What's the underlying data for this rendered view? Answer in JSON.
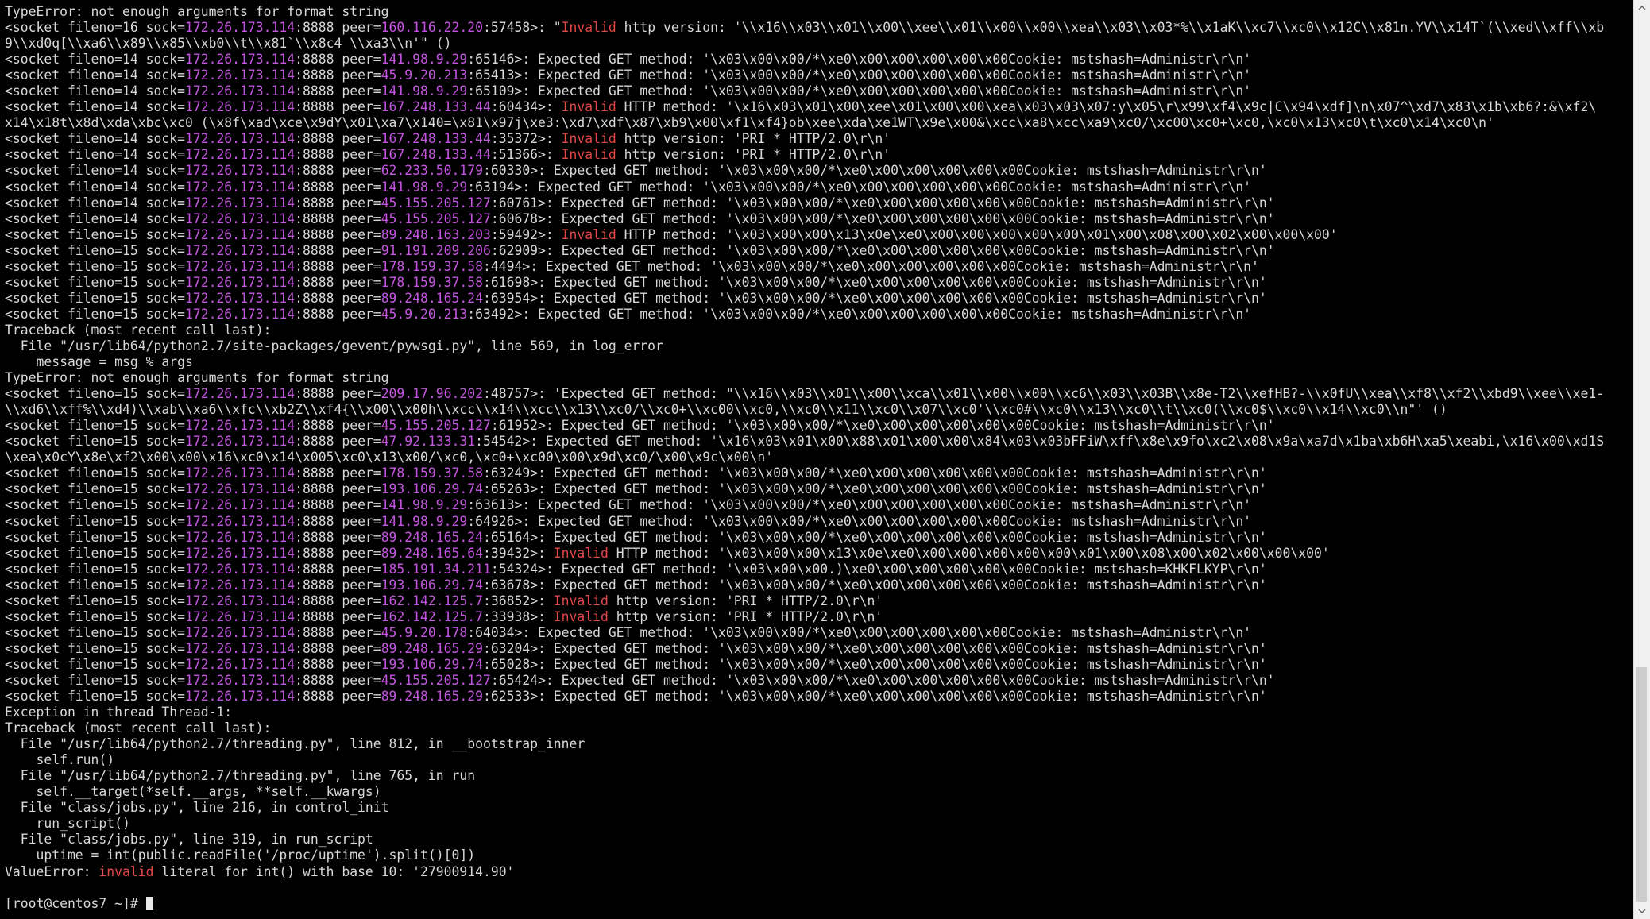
{
  "colors": {
    "background": "#000000",
    "text": "#d8d8d8",
    "ip_highlight": "#c455e0",
    "invalid_highlight": "#e04848",
    "scrollbar_track": "#f0f0f0",
    "scrollbar_thumb": "#cdcdcd"
  },
  "terminal": {
    "lines": [
      [
        {
          "t": "TypeError: not enough arguments for format string"
        }
      ],
      [
        {
          "t": "<socket fileno=16 sock="
        },
        {
          "t": "172.26.173.114",
          "c": "ip"
        },
        {
          "t": ":8888 peer="
        },
        {
          "t": "160.116.22.20",
          "c": "ip"
        },
        {
          "t": ":57458>: \""
        },
        {
          "t": "Invalid",
          "c": "kw"
        },
        {
          "t": " http version: '\\\\x16\\\\x03\\\\x01\\\\x00\\\\xee\\\\x01\\\\x00\\\\x00\\\\xea\\\\x03\\\\x03*%\\\\x1aK\\\\xc7\\\\xc0\\\\x12C\\\\x81n.YV\\\\x14T`(\\\\xed\\\\xff\\\\xb"
        }
      ],
      [
        {
          "t": "9\\\\xd0q[\\\\xa6\\\\x89\\\\x85\\\\xb0\\\\t\\\\x81`\\\\x8c4 \\\\xa3\\\\n'\" ()"
        }
      ],
      [
        {
          "t": "<socket fileno=14 sock="
        },
        {
          "t": "172.26.173.114",
          "c": "ip"
        },
        {
          "t": ":8888 peer="
        },
        {
          "t": "141.98.9.29",
          "c": "ip"
        },
        {
          "t": ":65146>: Expected GET method: '\\x03\\x00\\x00/*\\xe0\\x00\\x00\\x00\\x00\\x00Cookie: mstshash=Administr\\r\\n'"
        }
      ],
      [
        {
          "t": "<socket fileno=14 sock="
        },
        {
          "t": "172.26.173.114",
          "c": "ip"
        },
        {
          "t": ":8888 peer="
        },
        {
          "t": "45.9.20.213",
          "c": "ip"
        },
        {
          "t": ":65413>: Expected GET method: '\\x03\\x00\\x00/*\\xe0\\x00\\x00\\x00\\x00\\x00Cookie: mstshash=Administr\\r\\n'"
        }
      ],
      [
        {
          "t": "<socket fileno=14 sock="
        },
        {
          "t": "172.26.173.114",
          "c": "ip"
        },
        {
          "t": ":8888 peer="
        },
        {
          "t": "141.98.9.29",
          "c": "ip"
        },
        {
          "t": ":65109>: Expected GET method: '\\x03\\x00\\x00/*\\xe0\\x00\\x00\\x00\\x00\\x00Cookie: mstshash=Administr\\r\\n'"
        }
      ],
      [
        {
          "t": "<socket fileno=14 sock="
        },
        {
          "t": "172.26.173.114",
          "c": "ip"
        },
        {
          "t": ":8888 peer="
        },
        {
          "t": "167.248.133.44",
          "c": "ip"
        },
        {
          "t": ":60434>: "
        },
        {
          "t": "Invalid",
          "c": "kw"
        },
        {
          "t": " HTTP method: '\\x16\\x03\\x01\\x00\\xee\\x01\\x00\\x00\\xea\\x03\\x03\\x07:y\\x05\\r\\x99\\xf4\\x9c|C\\x94\\xdf]\\n\\x07^\\xd7\\x83\\x1b\\xb6?:&\\xf2\\"
        }
      ],
      [
        {
          "t": "x14\\x18t\\x8d\\xda\\xbc\\xc0 (\\x8f\\xad\\xce\\x9dY\\x01\\xa7\\x140=\\x81\\x97j\\xe3:\\xd7\\xdf\\x87\\xb9\\x00\\xf1\\xf4}ob\\xee\\xda\\xe1WT\\x9e\\x00&\\xcc\\xa8\\xcc\\xa9\\xc0/\\xc00\\xc0+\\xc0,\\xc0\\x13\\xc0\\t\\xc0\\x14\\xc0\\n'"
        }
      ],
      [
        {
          "t": "<socket fileno=14 sock="
        },
        {
          "t": "172.26.173.114",
          "c": "ip"
        },
        {
          "t": ":8888 peer="
        },
        {
          "t": "167.248.133.44",
          "c": "ip"
        },
        {
          "t": ":35372>: "
        },
        {
          "t": "Invalid",
          "c": "kw"
        },
        {
          "t": " http version: 'PRI * HTTP/2.0\\r\\n'"
        }
      ],
      [
        {
          "t": "<socket fileno=14 sock="
        },
        {
          "t": "172.26.173.114",
          "c": "ip"
        },
        {
          "t": ":8888 peer="
        },
        {
          "t": "167.248.133.44",
          "c": "ip"
        },
        {
          "t": ":51366>: "
        },
        {
          "t": "Invalid",
          "c": "kw"
        },
        {
          "t": " http version: 'PRI * HTTP/2.0\\r\\n'"
        }
      ],
      [
        {
          "t": "<socket fileno=14 sock="
        },
        {
          "t": "172.26.173.114",
          "c": "ip"
        },
        {
          "t": ":8888 peer="
        },
        {
          "t": "62.233.50.179",
          "c": "ip"
        },
        {
          "t": ":60330>: Expected GET method: '\\x03\\x00\\x00/*\\xe0\\x00\\x00\\x00\\x00\\x00Cookie: mstshash=Administr\\r\\n'"
        }
      ],
      [
        {
          "t": "<socket fileno=14 sock="
        },
        {
          "t": "172.26.173.114",
          "c": "ip"
        },
        {
          "t": ":8888 peer="
        },
        {
          "t": "141.98.9.29",
          "c": "ip"
        },
        {
          "t": ":63194>: Expected GET method: '\\x03\\x00\\x00/*\\xe0\\x00\\x00\\x00\\x00\\x00Cookie: mstshash=Administr\\r\\n'"
        }
      ],
      [
        {
          "t": "<socket fileno=14 sock="
        },
        {
          "t": "172.26.173.114",
          "c": "ip"
        },
        {
          "t": ":8888 peer="
        },
        {
          "t": "45.155.205.127",
          "c": "ip"
        },
        {
          "t": ":60761>: Expected GET method: '\\x03\\x00\\x00/*\\xe0\\x00\\x00\\x00\\x00\\x00Cookie: mstshash=Administr\\r\\n'"
        }
      ],
      [
        {
          "t": "<socket fileno=14 sock="
        },
        {
          "t": "172.26.173.114",
          "c": "ip"
        },
        {
          "t": ":8888 peer="
        },
        {
          "t": "45.155.205.127",
          "c": "ip"
        },
        {
          "t": ":60678>: Expected GET method: '\\x03\\x00\\x00/*\\xe0\\x00\\x00\\x00\\x00\\x00Cookie: mstshash=Administr\\r\\n'"
        }
      ],
      [
        {
          "t": "<socket fileno=15 sock="
        },
        {
          "t": "172.26.173.114",
          "c": "ip"
        },
        {
          "t": ":8888 peer="
        },
        {
          "t": "89.248.163.203",
          "c": "ip"
        },
        {
          "t": ":59492>: "
        },
        {
          "t": "Invalid",
          "c": "kw"
        },
        {
          "t": " HTTP method: '\\x03\\x00\\x00\\x13\\x0e\\xe0\\x00\\x00\\x00\\x00\\x00\\x01\\x00\\x08\\x00\\x02\\x00\\x00\\x00'"
        }
      ],
      [
        {
          "t": "<socket fileno=15 sock="
        },
        {
          "t": "172.26.173.114",
          "c": "ip"
        },
        {
          "t": ":8888 peer="
        },
        {
          "t": "91.191.209.206",
          "c": "ip"
        },
        {
          "t": ":62909>: Expected GET method: '\\x03\\x00\\x00/*\\xe0\\x00\\x00\\x00\\x00\\x00Cookie: mstshash=Administr\\r\\n'"
        }
      ],
      [
        {
          "t": "<socket fileno=15 sock="
        },
        {
          "t": "172.26.173.114",
          "c": "ip"
        },
        {
          "t": ":8888 peer="
        },
        {
          "t": "178.159.37.58",
          "c": "ip"
        },
        {
          "t": ":4494>: Expected GET method: '\\x03\\x00\\x00/*\\xe0\\x00\\x00\\x00\\x00\\x00Cookie: mstshash=Administr\\r\\n'"
        }
      ],
      [
        {
          "t": "<socket fileno=15 sock="
        },
        {
          "t": "172.26.173.114",
          "c": "ip"
        },
        {
          "t": ":8888 peer="
        },
        {
          "t": "178.159.37.58",
          "c": "ip"
        },
        {
          "t": ":61698>: Expected GET method: '\\x03\\x00\\x00/*\\xe0\\x00\\x00\\x00\\x00\\x00Cookie: mstshash=Administr\\r\\n'"
        }
      ],
      [
        {
          "t": "<socket fileno=15 sock="
        },
        {
          "t": "172.26.173.114",
          "c": "ip"
        },
        {
          "t": ":8888 peer="
        },
        {
          "t": "89.248.165.24",
          "c": "ip"
        },
        {
          "t": ":63954>: Expected GET method: '\\x03\\x00\\x00/*\\xe0\\x00\\x00\\x00\\x00\\x00Cookie: mstshash=Administr\\r\\n'"
        }
      ],
      [
        {
          "t": "<socket fileno=15 sock="
        },
        {
          "t": "172.26.173.114",
          "c": "ip"
        },
        {
          "t": ":8888 peer="
        },
        {
          "t": "45.9.20.213",
          "c": "ip"
        },
        {
          "t": ":63492>: Expected GET method: '\\x03\\x00\\x00/*\\xe0\\x00\\x00\\x00\\x00\\x00Cookie: mstshash=Administr\\r\\n'"
        }
      ],
      [
        {
          "t": "Traceback (most recent call last):"
        }
      ],
      [
        {
          "t": "  File \"/usr/lib64/python2.7/site-packages/gevent/pywsgi.py\", line 569, in log_error"
        }
      ],
      [
        {
          "t": "    message = msg % args"
        }
      ],
      [
        {
          "t": "TypeError: not enough arguments for format string"
        }
      ],
      [
        {
          "t": "<socket fileno=15 sock="
        },
        {
          "t": "172.26.173.114",
          "c": "ip"
        },
        {
          "t": ":8888 peer="
        },
        {
          "t": "209.17.96.202",
          "c": "ip"
        },
        {
          "t": ":48757>: 'Expected GET method: \"\\\\x16\\\\x03\\\\x01\\\\x00\\\\xca\\\\x01\\\\x00\\\\x00\\\\xc6\\\\x03\\\\x03B\\\\x8e-T2\\\\xefHB?-\\\\x0fU\\\\xea\\\\xf8\\\\xf2\\\\xbd9\\\\xee\\\\xe1-"
        }
      ],
      [
        {
          "t": "\\\\xd6\\\\xff%\\\\xd4)\\\\xab\\\\xa6\\\\xfc\\\\xb2Z\\\\xf4{\\\\x00\\\\x00h\\\\xcc\\\\x14\\\\xcc\\\\x13\\\\xc0/\\\\xc0+\\\\xc00\\\\xc0,\\\\xc0\\\\x11\\\\xc0\\\\x07\\\\xc0'\\\\xc0#\\\\xc0\\\\x13\\\\xc0\\\\t\\\\xc0(\\\\xc0$\\\\xc0\\\\x14\\\\xc0\\\\n\"' ()"
        }
      ],
      [
        {
          "t": "<socket fileno=15 sock="
        },
        {
          "t": "172.26.173.114",
          "c": "ip"
        },
        {
          "t": ":8888 peer="
        },
        {
          "t": "45.155.205.127",
          "c": "ip"
        },
        {
          "t": ":61952>: Expected GET method: '\\x03\\x00\\x00/*\\xe0\\x00\\x00\\x00\\x00\\x00Cookie: mstshash=Administr\\r\\n'"
        }
      ],
      [
        {
          "t": "<socket fileno=15 sock="
        },
        {
          "t": "172.26.173.114",
          "c": "ip"
        },
        {
          "t": ":8888 peer="
        },
        {
          "t": "47.92.133.31",
          "c": "ip"
        },
        {
          "t": ":54542>: Expected GET method: '\\x16\\x03\\x01\\x00\\x88\\x01\\x00\\x00\\x84\\x03\\x03bFFiW\\xff\\x8e\\x9fo\\xc2\\x08\\x9a\\xa7d\\x1ba\\xb6H\\xa5\\xeabi,\\x16\\x00\\xd1S"
        }
      ],
      [
        {
          "t": "\\xea\\x0cY\\x8e\\xf2\\x00\\x00\\x16\\xc0\\x14\\x005\\xc0\\x13\\x00/\\xc0,\\xc0+\\xc00\\x00\\x9d\\xc0/\\x00\\x9c\\x00\\n'"
        }
      ],
      [
        {
          "t": "<socket fileno=15 sock="
        },
        {
          "t": "172.26.173.114",
          "c": "ip"
        },
        {
          "t": ":8888 peer="
        },
        {
          "t": "178.159.37.58",
          "c": "ip"
        },
        {
          "t": ":63249>: Expected GET method: '\\x03\\x00\\x00/*\\xe0\\x00\\x00\\x00\\x00\\x00Cookie: mstshash=Administr\\r\\n'"
        }
      ],
      [
        {
          "t": "<socket fileno=15 sock="
        },
        {
          "t": "172.26.173.114",
          "c": "ip"
        },
        {
          "t": ":8888 peer="
        },
        {
          "t": "193.106.29.74",
          "c": "ip"
        },
        {
          "t": ":65263>: Expected GET method: '\\x03\\x00\\x00/*\\xe0\\x00\\x00\\x00\\x00\\x00Cookie: mstshash=Administr\\r\\n'"
        }
      ],
      [
        {
          "t": "<socket fileno=15 sock="
        },
        {
          "t": "172.26.173.114",
          "c": "ip"
        },
        {
          "t": ":8888 peer="
        },
        {
          "t": "141.98.9.29",
          "c": "ip"
        },
        {
          "t": ":63613>: Expected GET method: '\\x03\\x00\\x00/*\\xe0\\x00\\x00\\x00\\x00\\x00Cookie: mstshash=Administr\\r\\n'"
        }
      ],
      [
        {
          "t": "<socket fileno=15 sock="
        },
        {
          "t": "172.26.173.114",
          "c": "ip"
        },
        {
          "t": ":8888 peer="
        },
        {
          "t": "141.98.9.29",
          "c": "ip"
        },
        {
          "t": ":64926>: Expected GET method: '\\x03\\x00\\x00/*\\xe0\\x00\\x00\\x00\\x00\\x00Cookie: mstshash=Administr\\r\\n'"
        }
      ],
      [
        {
          "t": "<socket fileno=15 sock="
        },
        {
          "t": "172.26.173.114",
          "c": "ip"
        },
        {
          "t": ":8888 peer="
        },
        {
          "t": "89.248.165.24",
          "c": "ip"
        },
        {
          "t": ":65164>: Expected GET method: '\\x03\\x00\\x00/*\\xe0\\x00\\x00\\x00\\x00\\x00Cookie: mstshash=Administr\\r\\n'"
        }
      ],
      [
        {
          "t": "<socket fileno=15 sock="
        },
        {
          "t": "172.26.173.114",
          "c": "ip"
        },
        {
          "t": ":8888 peer="
        },
        {
          "t": "89.248.165.64",
          "c": "ip"
        },
        {
          "t": ":39432>: "
        },
        {
          "t": "Invalid",
          "c": "kw"
        },
        {
          "t": " HTTP method: '\\x03\\x00\\x00\\x13\\x0e\\xe0\\x00\\x00\\x00\\x00\\x00\\x01\\x00\\x08\\x00\\x02\\x00\\x00\\x00'"
        }
      ],
      [
        {
          "t": "<socket fileno=15 sock="
        },
        {
          "t": "172.26.173.114",
          "c": "ip"
        },
        {
          "t": ":8888 peer="
        },
        {
          "t": "185.191.34.211",
          "c": "ip"
        },
        {
          "t": ":54324>: Expected GET method: '\\x03\\x00\\x00.)\\xe0\\x00\\x00\\x00\\x00\\x00Cookie: mstshash=KHKFLKYP\\r\\n'"
        }
      ],
      [
        {
          "t": "<socket fileno=15 sock="
        },
        {
          "t": "172.26.173.114",
          "c": "ip"
        },
        {
          "t": ":8888 peer="
        },
        {
          "t": "193.106.29.74",
          "c": "ip"
        },
        {
          "t": ":63678>: Expected GET method: '\\x03\\x00\\x00/*\\xe0\\x00\\x00\\x00\\x00\\x00Cookie: mstshash=Administr\\r\\n'"
        }
      ],
      [
        {
          "t": "<socket fileno=15 sock="
        },
        {
          "t": "172.26.173.114",
          "c": "ip"
        },
        {
          "t": ":8888 peer="
        },
        {
          "t": "162.142.125.7",
          "c": "ip"
        },
        {
          "t": ":36852>: "
        },
        {
          "t": "Invalid",
          "c": "kw"
        },
        {
          "t": " http version: 'PRI * HTTP/2.0\\r\\n'"
        }
      ],
      [
        {
          "t": "<socket fileno=15 sock="
        },
        {
          "t": "172.26.173.114",
          "c": "ip"
        },
        {
          "t": ":8888 peer="
        },
        {
          "t": "162.142.125.7",
          "c": "ip"
        },
        {
          "t": ":33938>: "
        },
        {
          "t": "Invalid",
          "c": "kw"
        },
        {
          "t": " http version: 'PRI * HTTP/2.0\\r\\n'"
        }
      ],
      [
        {
          "t": "<socket fileno=15 sock="
        },
        {
          "t": "172.26.173.114",
          "c": "ip"
        },
        {
          "t": ":8888 peer="
        },
        {
          "t": "45.9.20.178",
          "c": "ip"
        },
        {
          "t": ":64034>: Expected GET method: '\\x03\\x00\\x00/*\\xe0\\x00\\x00\\x00\\x00\\x00Cookie: mstshash=Administr\\r\\n'"
        }
      ],
      [
        {
          "t": "<socket fileno=15 sock="
        },
        {
          "t": "172.26.173.114",
          "c": "ip"
        },
        {
          "t": ":8888 peer="
        },
        {
          "t": "89.248.165.29",
          "c": "ip"
        },
        {
          "t": ":63204>: Expected GET method: '\\x03\\x00\\x00/*\\xe0\\x00\\x00\\x00\\x00\\x00Cookie: mstshash=Administr\\r\\n'"
        }
      ],
      [
        {
          "t": "<socket fileno=15 sock="
        },
        {
          "t": "172.26.173.114",
          "c": "ip"
        },
        {
          "t": ":8888 peer="
        },
        {
          "t": "193.106.29.74",
          "c": "ip"
        },
        {
          "t": ":65028>: Expected GET method: '\\x03\\x00\\x00/*\\xe0\\x00\\x00\\x00\\x00\\x00Cookie: mstshash=Administr\\r\\n'"
        }
      ],
      [
        {
          "t": "<socket fileno=15 sock="
        },
        {
          "t": "172.26.173.114",
          "c": "ip"
        },
        {
          "t": ":8888 peer="
        },
        {
          "t": "45.155.205.127",
          "c": "ip"
        },
        {
          "t": ":65424>: Expected GET method: '\\x03\\x00\\x00/*\\xe0\\x00\\x00\\x00\\x00\\x00Cookie: mstshash=Administr\\r\\n'"
        }
      ],
      [
        {
          "t": "<socket fileno=15 sock="
        },
        {
          "t": "172.26.173.114",
          "c": "ip"
        },
        {
          "t": ":8888 peer="
        },
        {
          "t": "89.248.165.29",
          "c": "ip"
        },
        {
          "t": ":62533>: Expected GET method: '\\x03\\x00\\x00/*\\xe0\\x00\\x00\\x00\\x00\\x00Cookie: mstshash=Administr\\r\\n'"
        }
      ],
      [
        {
          "t": "Exception in thread Thread-1:"
        }
      ],
      [
        {
          "t": "Traceback (most recent call last):"
        }
      ],
      [
        {
          "t": "  File \"/usr/lib64/python2.7/threading.py\", line 812, in __bootstrap_inner"
        }
      ],
      [
        {
          "t": "    self.run()"
        }
      ],
      [
        {
          "t": "  File \"/usr/lib64/python2.7/threading.py\", line 765, in run"
        }
      ],
      [
        {
          "t": "    self.__target(*self.__args, **self.__kwargs)"
        }
      ],
      [
        {
          "t": "  File \"class/jobs.py\", line 216, in control_init"
        }
      ],
      [
        {
          "t": "    run_script()"
        }
      ],
      [
        {
          "t": "  File \"class/jobs.py\", line 319, in run_script"
        }
      ],
      [
        {
          "t": "    uptime = int(public.readFile('/proc/uptime').split()[0])"
        }
      ],
      [
        {
          "t": "ValueError: "
        },
        {
          "t": "invalid",
          "c": "kw"
        },
        {
          "t": " literal for int() with base 10: '27900914.90'"
        }
      ],
      [
        {
          "t": ""
        }
      ]
    ],
    "prompt": "[root@centos7 ~]# "
  },
  "scrollbar": {
    "up_icon": "chevron-up-icon",
    "down_icon": "chevron-down-icon",
    "position_fraction": 1.0
  }
}
